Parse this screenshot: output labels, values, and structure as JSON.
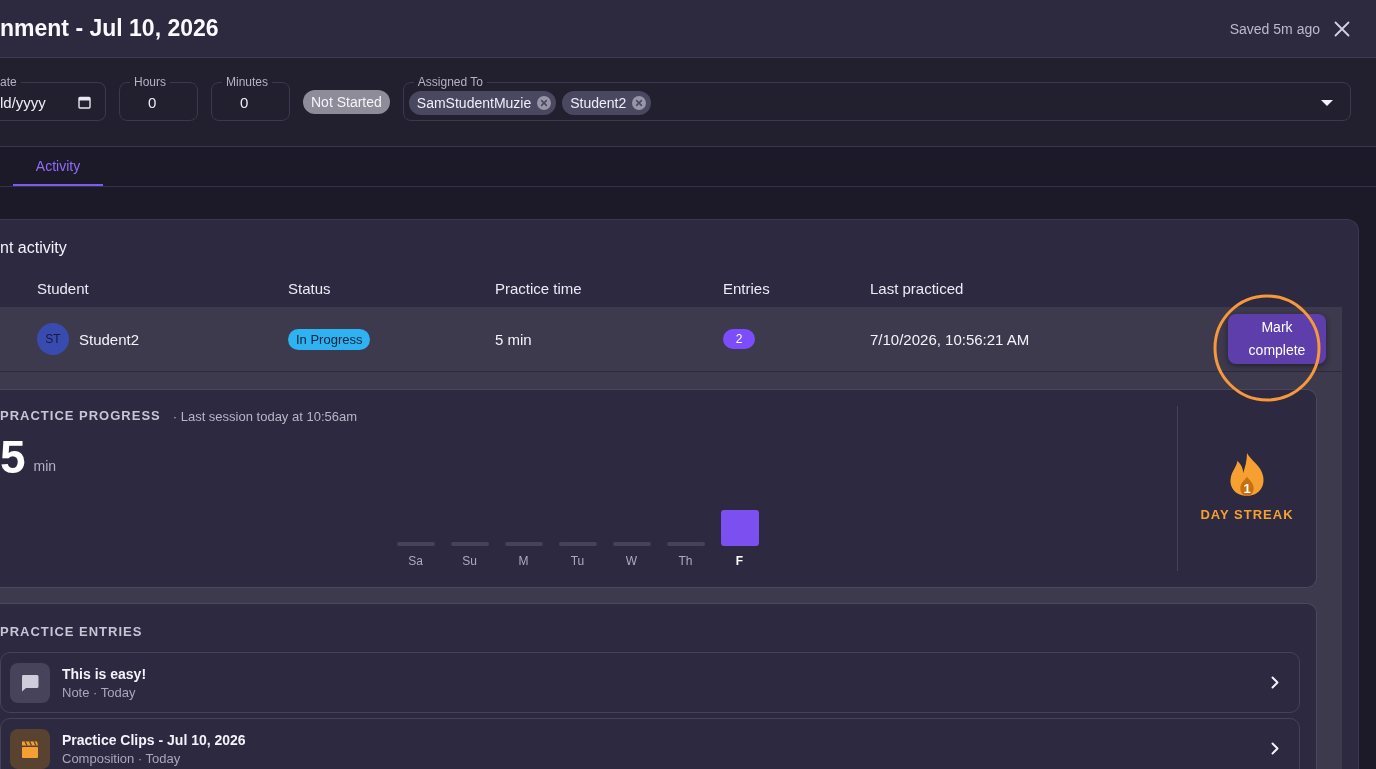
{
  "header": {
    "title": "nment - Jul 10, 2026",
    "saved_status": "Saved 5m ago"
  },
  "fields": {
    "date": {
      "label": "ate",
      "value": "ld/yyyy"
    },
    "hours": {
      "label": "Hours",
      "value": "0"
    },
    "minutes": {
      "label": "Minutes",
      "value": "0"
    },
    "status": "Not Started",
    "assigned_to": {
      "label": "Assigned To",
      "chips": [
        "SamStudentMuzie",
        "Student2"
      ]
    }
  },
  "tabs": [
    {
      "label": "Activity",
      "selected": true
    }
  ],
  "activity": {
    "title": "nt activity",
    "columns": [
      "Student",
      "Status",
      "Practice time",
      "Entries",
      "Last practiced"
    ],
    "rows": [
      {
        "initials": "ST",
        "student": "Student2",
        "status": "In Progress",
        "practice_time": "5 min",
        "entries": "2",
        "last_practiced": "7/10/2026, 10:56:21 AM",
        "action": {
          "label": "Mark complete",
          "circled": true
        },
        "expanded": true
      }
    ]
  },
  "practice_progress": {
    "title": "PRACTICE PROGRESS",
    "subtitle": "· Last session today at 10:56am",
    "total": "5",
    "unit": "min",
    "days": [
      {
        "label": "Sa",
        "practiced": false,
        "current": false
      },
      {
        "label": "Su",
        "practiced": false,
        "current": false
      },
      {
        "label": "M",
        "practiced": false,
        "current": false
      },
      {
        "label": "Tu",
        "practiced": false,
        "current": false
      },
      {
        "label": "W",
        "practiced": false,
        "current": false
      },
      {
        "label": "Th",
        "practiced": false,
        "current": false
      },
      {
        "label": "F",
        "practiced": true,
        "current": true
      }
    ],
    "streak": {
      "count": "1",
      "label": "DAY STREAK"
    }
  },
  "practice_entries": {
    "title": "PRACTICE ENTRIES",
    "items": [
      {
        "kind": "note",
        "title": "This is easy!",
        "subtitle": "Note · Today"
      },
      {
        "kind": "clip",
        "title": "Practice Clips - Jul 10, 2026",
        "subtitle": "Composition · Today"
      }
    ]
  }
}
